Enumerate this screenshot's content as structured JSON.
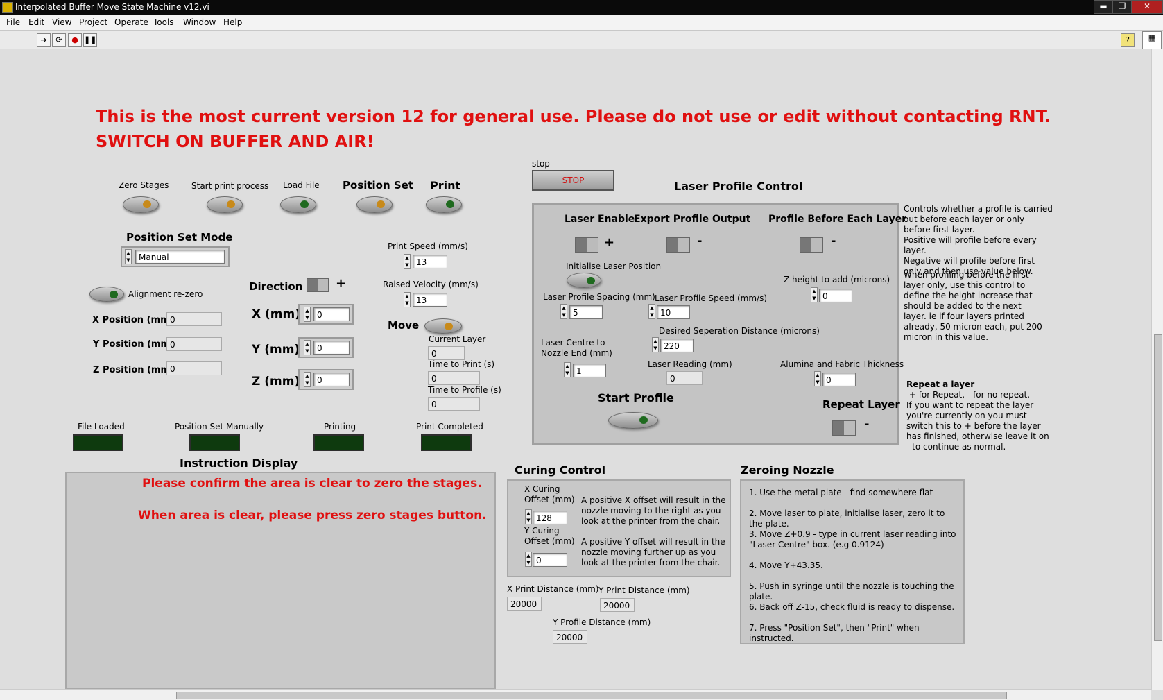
{
  "window": {
    "title": "Interpolated Buffer Move State Machine v12.vi",
    "min": "▬",
    "max": "❐",
    "close": "✕"
  },
  "menu": [
    "File",
    "Edit",
    "View",
    "Project",
    "Operate",
    "Tools",
    "Window",
    "Help"
  ],
  "help_glyph": "?",
  "banner": {
    "line1": "This is the most current version 12 for general use. Please do not use or edit without contacting RNT.",
    "line2": "SWITCH ON BUFFER AND AIR!"
  },
  "buttons": {
    "zero_stages": "Zero Stages",
    "start_print_process": "Start print process",
    "load_file": "Load File",
    "position_set": "Position Set",
    "print": "Print",
    "alignment_rezero": "Alignment re-zero",
    "move": "Move",
    "stop_label": "stop",
    "stop_button": "STOP"
  },
  "position_set_mode": {
    "label": "Position Set Mode",
    "value": "Manual"
  },
  "positions": {
    "x_label": "X Position (mm)",
    "x_value": "0",
    "y_label": "Y Position (mm)",
    "y_value": "0",
    "z_label": "Z Position (mm)",
    "z_value": "0"
  },
  "direction": {
    "label": "Direction",
    "sign": "+"
  },
  "moves": {
    "x_label": "X (mm)",
    "x_value": "0",
    "y_label": "Y (mm)",
    "y_value": "0",
    "z_label": "Z (mm)",
    "z_value": "0"
  },
  "speeds": {
    "print_speed_label": "Print Speed (mm/s)",
    "print_speed": "13",
    "raised_velocity_label": "Raised Velocity (mm/s)",
    "raised_velocity": "13"
  },
  "status": {
    "current_layer_label": "Current Layer",
    "current_layer": "0",
    "time_to_print_label": "Time to Print (s)",
    "time_to_print": "0",
    "time_to_profile_label": "Time to Profile (s)",
    "time_to_profile": "0"
  },
  "lamps": {
    "file_loaded": "File Loaded",
    "position_set_manually": "Position Set Manually",
    "printing": "Printing",
    "print_completed": "Print Completed"
  },
  "instruction": {
    "title": "Instruction Display",
    "line1": "Please confirm the area is clear to zero the stages.",
    "line2": "When area is clear, please press zero stages button."
  },
  "laser": {
    "title": "Laser Profile Control",
    "laser_enable": "Laser Enable",
    "laser_enable_sign": "+",
    "export_profile": "Export Profile Output",
    "export_sign": "-",
    "profile_each_layer": "Profile Before Each Layer",
    "profile_sign": "-",
    "init_laser": "Initialise Laser Position",
    "spacing_label": "Laser Profile Spacing (mm)",
    "spacing": "5",
    "speed_label": "Laser Profile Speed (mm/s)",
    "speed": "10",
    "z_height_label": "Z height to add (microns)",
    "z_height": "0",
    "sep_label": "Desired Seperation Distance (microns)",
    "sep": "220",
    "centre_label": "Laser Centre to Nozzle End (mm)",
    "centre": "1",
    "reading_label": "Laser Reading (mm)",
    "reading": "0",
    "alumina_label": "Alumina and Fabric Thickness",
    "alumina": "0",
    "start_profile": "Start Profile",
    "repeat_layer": "Repeat Layer",
    "repeat_sign": "-"
  },
  "notes": {
    "profile_note": "Controls whether a profile is carried out before each layer or only before first layer.\nPositive will profile before every layer.\nNegative will profile before first only and then use value below.",
    "z_note": "When profiling before the first layer only, use this control to define the height increase that should be added to the next layer. ie if four layers printed already, 50 micron each, put 200 micron in this value.",
    "repeat_title": "Repeat a layer",
    "repeat_note": " + for Repeat, - for no repeat.\nIf you want to repeat the layer you're currently on you must switch this to + before the layer has finished, otherwise leave it on - to continue as normal."
  },
  "curing": {
    "title": "Curing Control",
    "x_label": "X Curing Offset (mm)",
    "x_value": "128",
    "x_note": "A positive X offset will result in the nozzle moving to the right as you look at the printer from the chair.",
    "y_label": "Y Curing Offset (mm)",
    "y_value": "0",
    "y_note": "A positive Y offset will result in the nozzle moving further up as you look at the printer from the chair.",
    "xpd_label": "X Print Distance (mm)",
    "xpd": "20000",
    "ypd_label": "Y Print Distance (mm)",
    "ypd": "20000",
    "ypr_label": "Y Profile Distance (mm)",
    "ypr": "20000"
  },
  "zeroing": {
    "title": "Zeroing Nozzle",
    "steps": [
      "1. Use the metal plate - find somewhere flat",
      "2. Move laser to plate, initialise laser, zero it to the plate.",
      "3. Move Z+0.9 - type in current laser reading into \"Laser Centre\" box. (e.g 0.9124)",
      "4. Move Y+43.35.",
      "5. Push in syringe until the nozzle is touching the plate.",
      "6. Back off Z-15, check fluid is ready to dispense.",
      "7. Press \"Position Set\", then \"Print\" when instructed."
    ]
  }
}
